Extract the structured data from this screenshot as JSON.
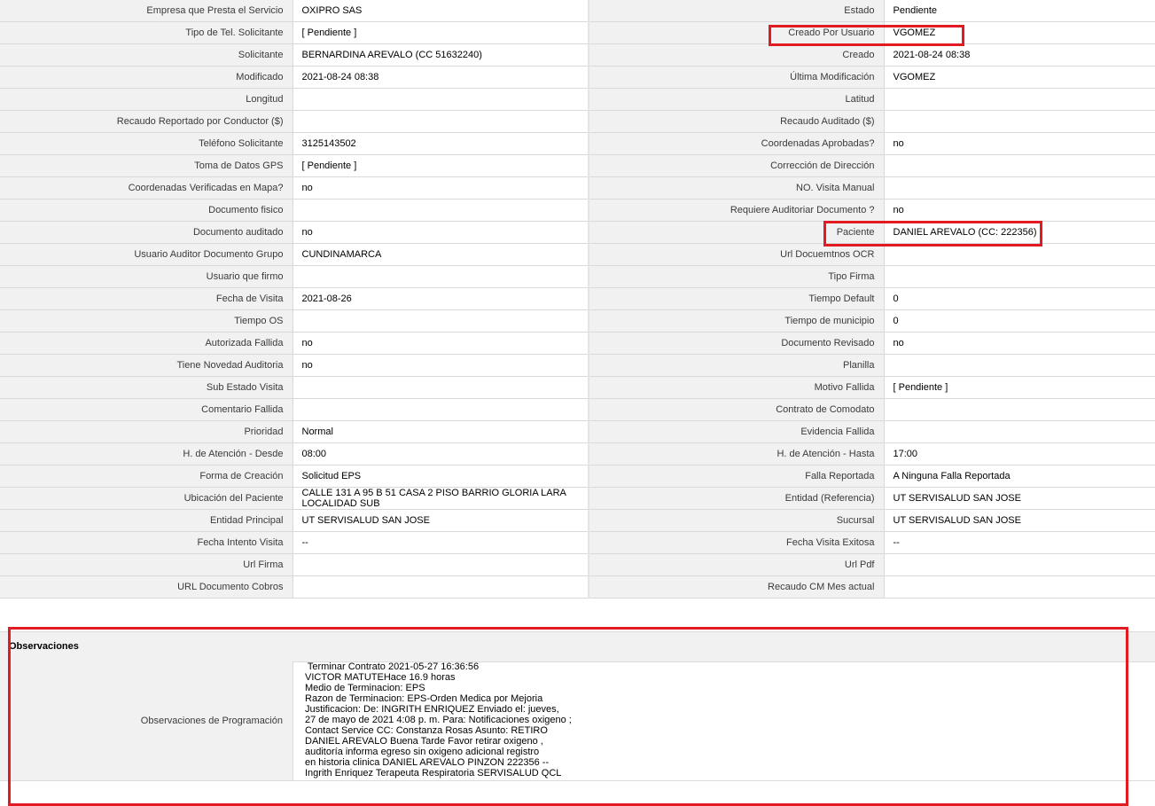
{
  "detail_rows": [
    {
      "left_label": "Empresa que Presta el Servicio",
      "left_value": "OXIPRO SAS",
      "right_label": "Estado",
      "right_value": "Pendiente"
    },
    {
      "left_label": "Tipo de Tel. Solicitante",
      "left_value": "[ Pendiente ]",
      "right_label": "Creado Por Usuario",
      "right_value": "VGOMEZ"
    },
    {
      "left_label": "Solicitante",
      "left_value": "BERNARDINA AREVALO (CC 51632240)",
      "right_label": "Creado",
      "right_value": "2021-08-24 08:38"
    },
    {
      "left_label": "Modificado",
      "left_value": "2021-08-24 08:38",
      "right_label": "Última Modificación",
      "right_value": "VGOMEZ"
    },
    {
      "left_label": "Longitud",
      "left_value": "",
      "right_label": "Latitud",
      "right_value": ""
    },
    {
      "left_label": "Recaudo Reportado por Conductor ($)",
      "left_value": "",
      "right_label": "Recaudo Auditado ($)",
      "right_value": ""
    },
    {
      "left_label": "Teléfono Solicitante",
      "left_value": "3125143502",
      "right_label": "Coordenadas Aprobadas?",
      "right_value": "no"
    },
    {
      "left_label": "Toma de Datos GPS",
      "left_value": "[ Pendiente ]",
      "right_label": "Corrección de Dirección",
      "right_value": ""
    },
    {
      "left_label": "Coordenadas Verificadas en Mapa?",
      "left_value": "no",
      "right_label": "NO. Visita Manual",
      "right_value": ""
    },
    {
      "left_label": "Documento fisico",
      "left_value": "",
      "right_label": "Requiere Auditoriar Documento ?",
      "right_value": "no"
    },
    {
      "left_label": "Documento auditado",
      "left_value": "no",
      "right_label": "Paciente",
      "right_value": "DANIEL AREVALO (CC: 222356)"
    },
    {
      "left_label": "Usuario Auditor Documento Grupo",
      "left_value": "CUNDINAMARCA",
      "right_label": "Url Docuemtnos OCR",
      "right_value": ""
    },
    {
      "left_label": "Usuario que firmo",
      "left_value": "",
      "right_label": "Tipo Firma",
      "right_value": ""
    },
    {
      "left_label": "Fecha de Visita",
      "left_value": "2021-08-26",
      "right_label": "Tiempo Default",
      "right_value": "0"
    },
    {
      "left_label": "Tiempo OS",
      "left_value": "",
      "right_label": "Tiempo de municipio",
      "right_value": "0"
    },
    {
      "left_label": "Autorizada Fallida",
      "left_value": "no",
      "right_label": "Documento Revisado",
      "right_value": "no"
    },
    {
      "left_label": "Tiene Novedad Auditoria",
      "left_value": "no",
      "right_label": "Planilla",
      "right_value": ""
    },
    {
      "left_label": "Sub Estado Visita",
      "left_value": "",
      "right_label": "Motivo Fallida",
      "right_value": "[ Pendiente ]"
    },
    {
      "left_label": "Comentario Fallida",
      "left_value": "",
      "right_label": "Contrato de Comodato",
      "right_value": ""
    },
    {
      "left_label": "Prioridad",
      "left_value": "Normal",
      "right_label": "Evidencia Fallida",
      "right_value": ""
    },
    {
      "left_label": "H. de Atención - Desde",
      "left_value": "08:00",
      "right_label": "H. de Atención - Hasta",
      "right_value": "17:00"
    },
    {
      "left_label": "Forma de Creación",
      "left_value": "Solicitud EPS",
      "right_label": "Falla Reportada",
      "right_value": "A Ninguna Falla Reportada"
    },
    {
      "left_label": "Ubicación del Paciente",
      "left_value": "CALLE 131 A 95 B 51 CASA 2 PISO BARRIO GLORIA LARA LOCALIDAD SUB",
      "right_label": "Entidad (Referencia)",
      "right_value": "UT SERVISALUD SAN JOSE"
    },
    {
      "left_label": "Entidad Principal",
      "left_value": "UT SERVISALUD SAN JOSE",
      "right_label": "Sucursal",
      "right_value": "UT SERVISALUD SAN JOSE"
    },
    {
      "left_label": "Fecha Intento Visita",
      "left_value": "--",
      "right_label": "Fecha Visita Exitosa",
      "right_value": "--"
    },
    {
      "left_label": "Url Firma",
      "left_value": "",
      "right_label": "Url Pdf",
      "right_value": ""
    },
    {
      "left_label": "URL Documento Cobros",
      "left_value": "",
      "right_label": "Recaudo CM Mes actual",
      "right_value": ""
    }
  ],
  "observaciones": {
    "section_title": "Observaciones",
    "label": "Observaciones de Programación",
    "lines": [
      " Terminar Contrato 2021-05-27 16:36:56",
      "VICTOR MATUTEHace 16.9 horas",
      "Medio de Terminacion: EPS",
      "Razon de Terminacion: EPS-Orden Medica por Mejoria",
      "Justificacion: De: INGRITH ENRIQUEZ Enviado el: jueves,",
      "27 de mayo de 2021 4:08 p. m. Para: Notificaciones oxigeno ;",
      "Contact Service CC: Constanza Rosas Asunto: RETIRO",
      "DANIEL AREVALO Buena Tarde Favor retirar oxigeno ,",
      "auditoría informa egreso sin oxigeno adicional registro",
      "en historia clinica DANIEL AREVALO PINZON 222356 --",
      "Ingrith Enriquez Terapeuta Respiratoria SERVISALUD QCL"
    ]
  },
  "highlight_color": "#e21b23"
}
